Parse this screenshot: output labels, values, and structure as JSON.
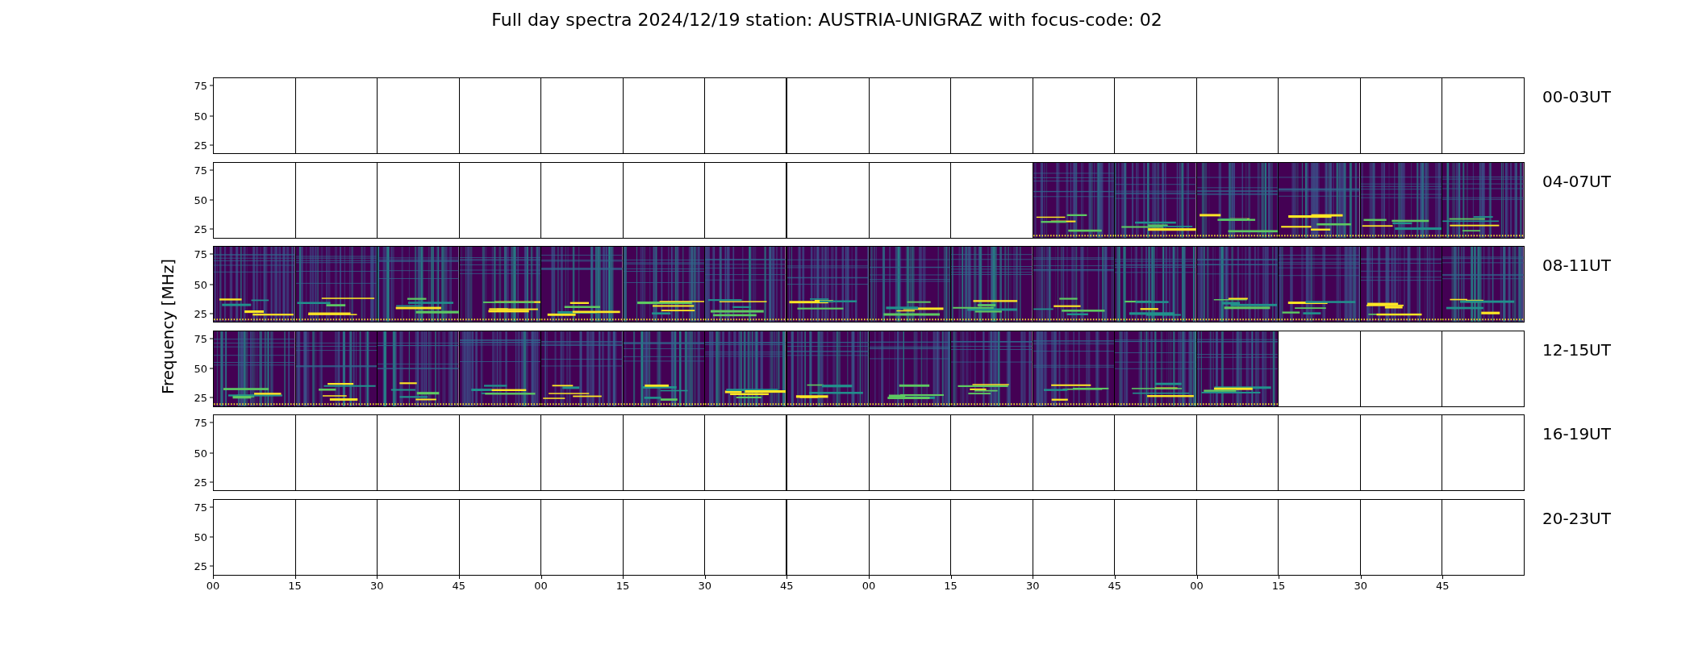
{
  "title": "Full day spectra 2024/12/19 station: AUSTRIA-UNIGRAZ with focus-code: 02",
  "y_axis_label": "Frequency [MHz]",
  "rows": [
    {
      "label": "00-03UT",
      "y_ticks": [
        "75",
        "50",
        "25"
      ],
      "panels": [
        {
          "filled": false
        },
        {
          "filled": false
        },
        {
          "filled": false
        },
        {
          "filled": false
        },
        {
          "filled": false
        },
        {
          "filled": false
        },
        {
          "filled": false
        },
        {
          "filled": false
        },
        {
          "filled": false
        },
        {
          "filled": false
        },
        {
          "filled": false
        },
        {
          "filled": false
        },
        {
          "filled": false
        },
        {
          "filled": false
        },
        {
          "filled": false
        },
        {
          "filled": false
        }
      ]
    },
    {
      "label": "04-07UT",
      "y_ticks": [
        "75",
        "50",
        "25"
      ],
      "panels": [
        {
          "filled": false
        },
        {
          "filled": false
        },
        {
          "filled": false
        },
        {
          "filled": false
        },
        {
          "filled": false
        },
        {
          "filled": false
        },
        {
          "filled": false
        },
        {
          "filled": false
        },
        {
          "filled": false
        },
        {
          "filled": false
        },
        {
          "filled": true
        },
        {
          "filled": true
        },
        {
          "filled": true
        },
        {
          "filled": true
        },
        {
          "filled": true
        },
        {
          "filled": true
        }
      ]
    },
    {
      "label": "08-11UT",
      "y_ticks": [
        "75",
        "50",
        "25"
      ],
      "panels": [
        {
          "filled": true
        },
        {
          "filled": true
        },
        {
          "filled": true
        },
        {
          "filled": true
        },
        {
          "filled": true
        },
        {
          "filled": true
        },
        {
          "filled": true
        },
        {
          "filled": true
        },
        {
          "filled": true
        },
        {
          "filled": true
        },
        {
          "filled": true
        },
        {
          "filled": true
        },
        {
          "filled": true
        },
        {
          "filled": true
        },
        {
          "filled": true
        },
        {
          "filled": true
        }
      ]
    },
    {
      "label": "12-15UT",
      "y_ticks": [
        "75",
        "50",
        "25"
      ],
      "panels": [
        {
          "filled": true
        },
        {
          "filled": true
        },
        {
          "filled": true
        },
        {
          "filled": true
        },
        {
          "filled": true
        },
        {
          "filled": true
        },
        {
          "filled": true
        },
        {
          "filled": true
        },
        {
          "filled": true
        },
        {
          "filled": true
        },
        {
          "filled": true
        },
        {
          "filled": true
        },
        {
          "filled": true
        },
        {
          "filled": false
        },
        {
          "filled": false
        },
        {
          "filled": false
        }
      ]
    },
    {
      "label": "16-19UT",
      "y_ticks": [
        "75",
        "50",
        "25"
      ],
      "panels": [
        {
          "filled": false
        },
        {
          "filled": false
        },
        {
          "filled": false
        },
        {
          "filled": false
        },
        {
          "filled": false
        },
        {
          "filled": false
        },
        {
          "filled": false
        },
        {
          "filled": false
        },
        {
          "filled": false
        },
        {
          "filled": false
        },
        {
          "filled": false
        },
        {
          "filled": false
        },
        {
          "filled": false
        },
        {
          "filled": false
        },
        {
          "filled": false
        },
        {
          "filled": false
        }
      ]
    },
    {
      "label": "20-23UT",
      "y_ticks": [
        "75",
        "50",
        "25"
      ],
      "panels": [
        {
          "filled": false
        },
        {
          "filled": false
        },
        {
          "filled": false
        },
        {
          "filled": false
        },
        {
          "filled": false
        },
        {
          "filled": false
        },
        {
          "filled": false
        },
        {
          "filled": false
        },
        {
          "filled": false
        },
        {
          "filled": false
        },
        {
          "filled": false
        },
        {
          "filled": false
        },
        {
          "filled": false
        },
        {
          "filled": false
        },
        {
          "filled": false
        },
        {
          "filled": false
        }
      ]
    }
  ],
  "x_ticks": [
    "00",
    "15",
    "30",
    "45",
    "00",
    "15",
    "30",
    "45",
    "00",
    "15",
    "30",
    "45",
    "00",
    "15",
    "30",
    "45"
  ]
}
